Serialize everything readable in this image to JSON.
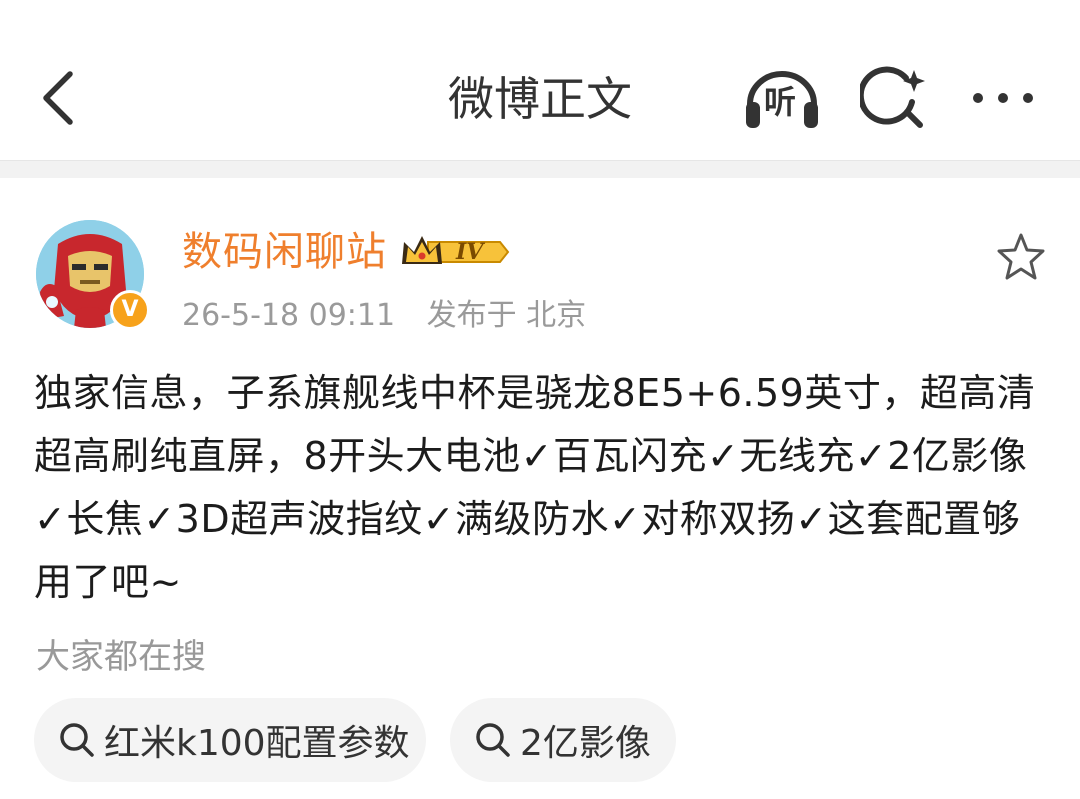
{
  "header": {
    "title": "微博正文",
    "back_icon": "chevron-left-icon",
    "listen_label": "听",
    "search_icon": "search-sparkle-icon",
    "more_icon": "more-dots-icon"
  },
  "post": {
    "author": {
      "name": "数码闲聊站",
      "level_badge": "IV",
      "avatar_icon": "iron-man-avatar",
      "verified_icon": "verified-v-icon",
      "verified_label": "V"
    },
    "timestamp": "26-5-18 09:11",
    "location": "发布于 北京",
    "favorite_icon": "star-outline-icon",
    "text": "独家信息，子系旗舰线中杯是骁龙8E5+6.59英寸，超高清超高刷纯直屏，8开头大电池✓百瓦闪充✓无线充✓2亿影像✓长焦✓3D超声波指纹✓满级防水✓对称双扬✓这套配置够用了吧~"
  },
  "search": {
    "hint": "大家都在搜",
    "chips": [
      {
        "label": "红米k100配置参数"
      },
      {
        "label": "2亿影像"
      }
    ]
  },
  "colors": {
    "username": "#ef7f2d",
    "badge_gold": "#f7b500",
    "muted": "#9a9a9a",
    "chip_bg": "#f4f4f4"
  }
}
